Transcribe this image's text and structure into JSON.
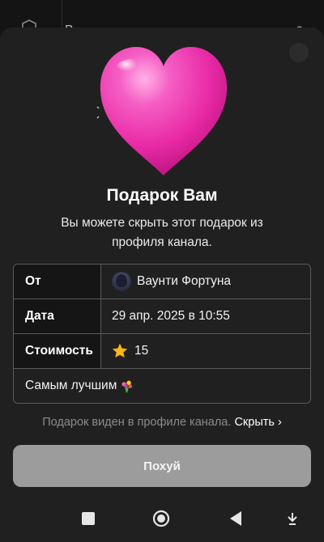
{
  "background": {
    "title": "В",
    "count": "3"
  },
  "gift": {
    "title": "Подарок Вам",
    "subtitle": "Вы можете скрыть этот подарок из профиля канала."
  },
  "details": {
    "from_label": "От",
    "from_value": "Ваунти Фортуна",
    "date_label": "Дата",
    "date_value": "29 апр. 2025 в 10:55",
    "cost_label": "Стоимость",
    "cost_value": "15",
    "message": "Самым лучшим"
  },
  "caption": {
    "text": "Подарок виден в профиле канала.",
    "link": "Скрыть ›"
  },
  "button": {
    "label": "Похуй"
  },
  "icons": {
    "heart": "pink-heart-icon",
    "star": "star-icon",
    "flower": "bouquet-icon",
    "nav": [
      "square-icon",
      "circle-home-icon",
      "back-triangle-icon",
      "download-arrow-icon"
    ]
  },
  "colors": {
    "sheet": "#202020",
    "heart": "#f03ab4",
    "button": "#9c9c9c"
  }
}
